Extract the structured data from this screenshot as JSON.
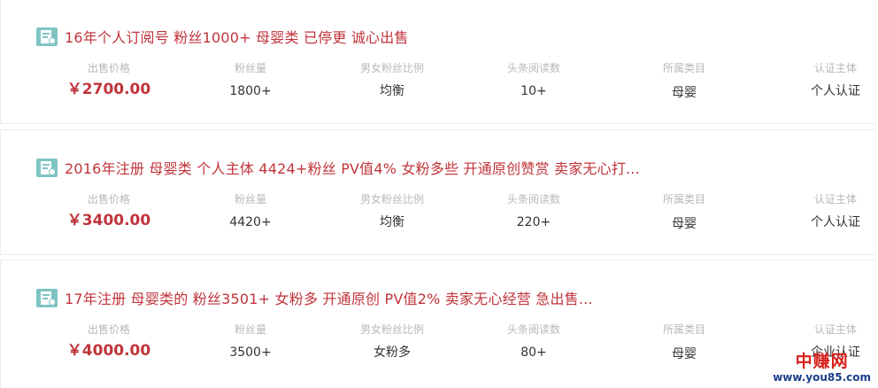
{
  "listings": [
    {
      "title": "16年个人订阅号 粉丝1000+ 母婴类 已停更 诚心出售",
      "stats": [
        {
          "label": "出售价格",
          "value": "￥2700.00"
        },
        {
          "label": "粉丝量",
          "value": "1800+"
        },
        {
          "label": "男女粉丝比例",
          "value": "均衡"
        },
        {
          "label": "头条阅读数",
          "value": "10+"
        },
        {
          "label": "所属类目",
          "value": "母婴"
        },
        {
          "label": "认证主体",
          "value": "个人认证"
        }
      ]
    },
    {
      "title": "2016年注册 母婴类 个人主体 4424+粉丝 PV值4% 女粉多些 开通原创赞赏 卖家无心打...",
      "stats": [
        {
          "label": "出售价格",
          "value": "￥3400.00"
        },
        {
          "label": "粉丝量",
          "value": "4420+"
        },
        {
          "label": "男女粉丝比例",
          "value": "均衡"
        },
        {
          "label": "头条阅读数",
          "value": "220+"
        },
        {
          "label": "所属类目",
          "value": "母婴"
        },
        {
          "label": "认证主体",
          "value": "个人认证"
        }
      ]
    },
    {
      "title": "17年注册 母婴类的 粉丝3501+ 女粉多 开通原创 PV值2% 卖家无心经营 急出售...",
      "stats": [
        {
          "label": "出售价格",
          "value": "￥4000.00"
        },
        {
          "label": "粉丝量",
          "value": "3500+"
        },
        {
          "label": "男女粉丝比例",
          "value": "女粉多"
        },
        {
          "label": "头条阅读数",
          "value": "80+"
        },
        {
          "label": "所属类目",
          "value": "母婴"
        },
        {
          "label": "认证主体",
          "value": "企业认证"
        }
      ]
    }
  ],
  "watermark": {
    "name": "中赚网",
    "url": "www.you85.com"
  },
  "colors": {
    "accent": "#c0343b",
    "icon": "#7fc4c3",
    "label": "#b8b8b8"
  }
}
